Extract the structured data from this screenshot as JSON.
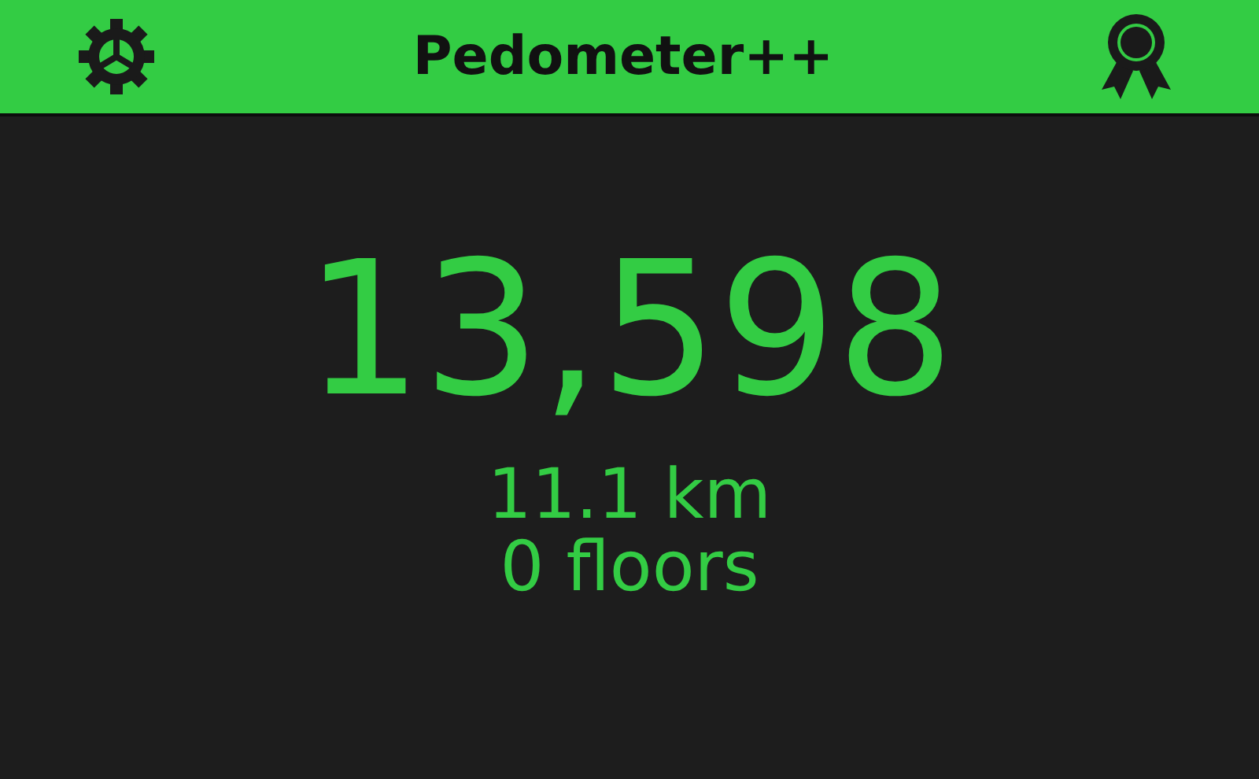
{
  "header": {
    "title": "Pedometer++"
  },
  "steps": "13,598",
  "distance": "11.1 km",
  "floors": "0 floors"
}
